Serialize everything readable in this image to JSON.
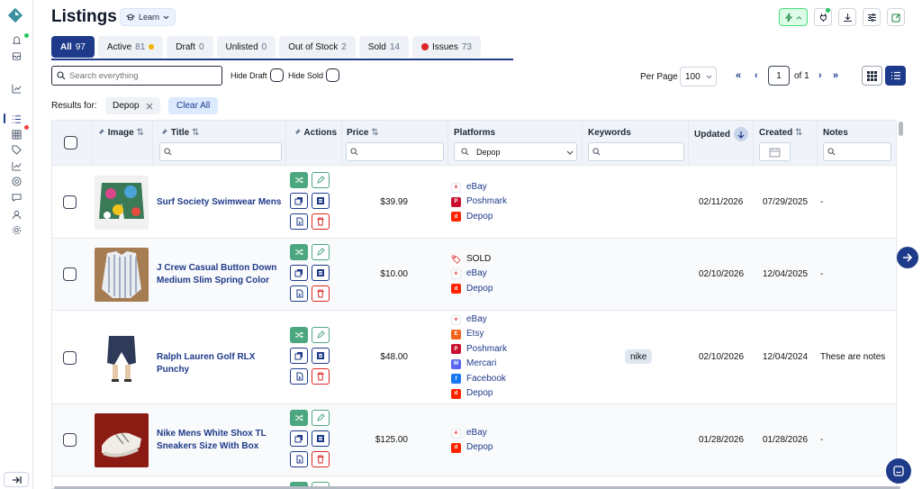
{
  "page": {
    "title": "Listings",
    "learn_label": "Learn"
  },
  "tabs": [
    {
      "label": "All",
      "count": "97",
      "active": true
    },
    {
      "label": "Active",
      "count": "81",
      "dot": "#f5b400"
    },
    {
      "label": "Draft",
      "count": "0"
    },
    {
      "label": "Unlisted",
      "count": "0"
    },
    {
      "label": "Out of Stock",
      "count": "2"
    },
    {
      "label": "Sold",
      "count": "14"
    },
    {
      "label": "Issues",
      "count": "73",
      "dot": "#dc2626"
    }
  ],
  "toolbar": {
    "search_placeholder": "Search everything",
    "hide_draft_label": "Hide Draft",
    "hide_sold_label": "Hide Sold",
    "per_page_label": "Per Page",
    "per_page_value": "100",
    "page_value": "1",
    "page_of": "of 1"
  },
  "filters": {
    "results_for_label": "Results for:",
    "chip_label": "Depop",
    "clear_all_label": "Clear All"
  },
  "table": {
    "columns": {
      "image": "Image",
      "title": "Title",
      "actions": "Actions",
      "price": "Price",
      "platforms": "Platforms",
      "platforms_filter": "Depop",
      "keywords": "Keywords",
      "updated": "Updated",
      "created": "Created",
      "notes": "Notes"
    },
    "rows": [
      {
        "title": "Surf Society Swimwear Mens",
        "price": "$39.99",
        "platforms": [
          "eBay",
          "Poshmark",
          "Depop"
        ],
        "keywords": "",
        "updated": "02/11/2026",
        "created": "07/29/2025",
        "notes": "-"
      },
      {
        "title": "J Crew Casual Button Down Medium Slim Spring Color",
        "price": "$10.00",
        "platforms": [
          "SOLD",
          "eBay",
          "Depop"
        ],
        "keywords": "",
        "updated": "02/10/2026",
        "created": "12/04/2025",
        "notes": "-"
      },
      {
        "title": "Ralph Lauren Golf RLX Punchy",
        "price": "$48.00",
        "platforms": [
          "eBay",
          "Etsy",
          "Poshmark",
          "Mercari",
          "Facebook",
          "Depop"
        ],
        "keywords": "nike",
        "updated": "02/10/2026",
        "created": "12/04/2024",
        "notes": "These are notes"
      },
      {
        "title": "Nike Mens White Shox TL Sneakers Size With Box",
        "price": "$125.00",
        "platforms": [
          "eBay",
          "Depop"
        ],
        "keywords": "",
        "updated": "01/28/2026",
        "created": "01/28/2026",
        "notes": "-"
      }
    ]
  },
  "colors": {
    "accent": "#1e3a8a",
    "green": "#4ca67f",
    "danger": "#dc2626"
  }
}
